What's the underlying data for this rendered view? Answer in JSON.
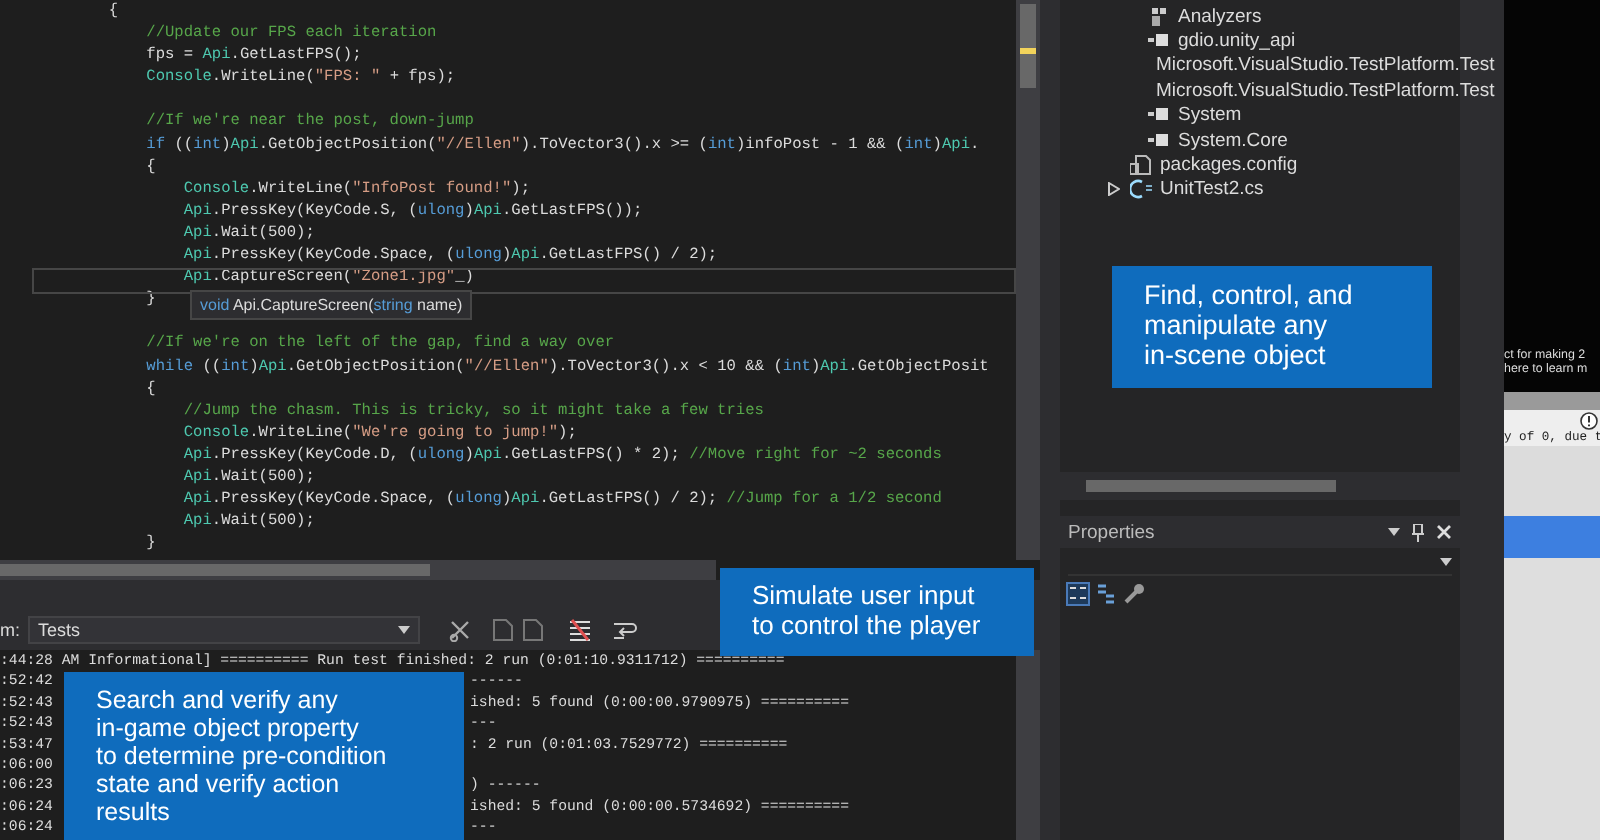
{
  "editor": {
    "lines": [
      {
        "kind": "code",
        "current": false,
        "tokens": [
          {
            "kind": "plain",
            "text": "        {"
          }
        ]
      },
      {
        "kind": "code",
        "current": false,
        "tokens": [
          {
            "kind": "comment",
            "text": "            //Update our FPS each iteration"
          }
        ]
      },
      {
        "kind": "code",
        "current": false,
        "tokens": [
          {
            "kind": "plain",
            "text": "            fps = "
          },
          {
            "kind": "class",
            "text": "Api"
          },
          {
            "kind": "plain",
            "text": ".GetLastFPS();"
          }
        ]
      },
      {
        "kind": "code",
        "current": false,
        "tokens": [
          {
            "kind": "class",
            "text": "            Console"
          },
          {
            "kind": "plain",
            "text": ".WriteLine("
          },
          {
            "kind": "string",
            "text": "\"FPS: \""
          },
          {
            "kind": "plain",
            "text": " + fps);"
          }
        ]
      },
      {
        "kind": "blank",
        "current": false
      },
      {
        "kind": "code",
        "current": false,
        "tokens": [
          {
            "kind": "comment",
            "text": "            //If we're near the post, down-jump"
          }
        ]
      },
      {
        "kind": "code",
        "current": false,
        "tokens": [
          {
            "kind": "keyword",
            "text": "            if"
          },
          {
            "kind": "plain",
            "text": " (("
          },
          {
            "kind": "keyword",
            "text": "int"
          },
          {
            "kind": "plain",
            "text": ")"
          },
          {
            "kind": "class",
            "text": "Api"
          },
          {
            "kind": "plain",
            "text": ".GetObjectPosition("
          },
          {
            "kind": "string",
            "text": "\"//Ellen\""
          },
          {
            "kind": "plain",
            "text": ").ToVector3().x >= ("
          },
          {
            "kind": "keyword",
            "text": "int"
          },
          {
            "kind": "plain",
            "text": ")infoPost - 1 && ("
          },
          {
            "kind": "keyword",
            "text": "int"
          },
          {
            "kind": "plain",
            "text": ")"
          },
          {
            "kind": "class",
            "text": "Api"
          },
          {
            "kind": "plain",
            "text": "."
          }
        ]
      },
      {
        "kind": "code",
        "current": false,
        "tokens": [
          {
            "kind": "plain",
            "text": "            {"
          }
        ]
      },
      {
        "kind": "code",
        "current": false,
        "tokens": [
          {
            "kind": "class",
            "text": "                Console"
          },
          {
            "kind": "plain",
            "text": ".WriteLine("
          },
          {
            "kind": "string",
            "text": "\"InfoPost found!\""
          },
          {
            "kind": "plain",
            "text": ");"
          }
        ]
      },
      {
        "kind": "code",
        "current": false,
        "tokens": [
          {
            "kind": "class",
            "text": "                Api"
          },
          {
            "kind": "plain",
            "text": ".PressKey(KeyCode.S, ("
          },
          {
            "kind": "keyword",
            "text": "ulong"
          },
          {
            "kind": "plain",
            "text": ")"
          },
          {
            "kind": "class",
            "text": "Api"
          },
          {
            "kind": "plain",
            "text": ".GetLastFPS());"
          }
        ]
      },
      {
        "kind": "code",
        "current": false,
        "tokens": [
          {
            "kind": "class",
            "text": "                Api"
          },
          {
            "kind": "plain",
            "text": ".Wait(500);"
          }
        ]
      },
      {
        "kind": "code",
        "current": false,
        "tokens": [
          {
            "kind": "class",
            "text": "                Api"
          },
          {
            "kind": "plain",
            "text": ".PressKey(KeyCode.Space, ("
          },
          {
            "kind": "keyword",
            "text": "ulong"
          },
          {
            "kind": "plain",
            "text": ")"
          },
          {
            "kind": "class",
            "text": "Api"
          },
          {
            "kind": "plain",
            "text": ".GetLastFPS() / 2);"
          }
        ]
      },
      {
        "kind": "code",
        "current": true,
        "tokens": [
          {
            "kind": "class",
            "text": "                Api"
          },
          {
            "kind": "plain",
            "text": ".CaptureScreen("
          },
          {
            "kind": "string",
            "text": "\"Zone1.jpg\""
          },
          {
            "kind": "plain",
            "text": "_)"
          }
        ]
      },
      {
        "kind": "code",
        "current": false,
        "tokens": [
          {
            "kind": "plain",
            "text": "            }"
          }
        ]
      },
      {
        "kind": "blank",
        "current": false
      },
      {
        "kind": "code",
        "current": false,
        "tokens": [
          {
            "kind": "comment",
            "text": "            //If we're on the left of the gap, find a way over"
          }
        ]
      },
      {
        "kind": "code",
        "current": false,
        "tokens": [
          {
            "kind": "keyword",
            "text": "            while"
          },
          {
            "kind": "plain",
            "text": " (("
          },
          {
            "kind": "keyword",
            "text": "int"
          },
          {
            "kind": "plain",
            "text": ")"
          },
          {
            "kind": "class",
            "text": "Api"
          },
          {
            "kind": "plain",
            "text": ".GetObjectPosition("
          },
          {
            "kind": "string",
            "text": "\"//Ellen\""
          },
          {
            "kind": "plain",
            "text": ").ToVector3().x < 10 && ("
          },
          {
            "kind": "keyword",
            "text": "int"
          },
          {
            "kind": "plain",
            "text": ")"
          },
          {
            "kind": "class",
            "text": "Api"
          },
          {
            "kind": "plain",
            "text": ".GetObjectPosit"
          }
        ]
      },
      {
        "kind": "code",
        "current": false,
        "tokens": [
          {
            "kind": "plain",
            "text": "            {"
          }
        ]
      },
      {
        "kind": "code",
        "current": false,
        "tokens": [
          {
            "kind": "comment",
            "text": "                //Jump the chasm. This is tricky, so it might take a few tries"
          }
        ]
      },
      {
        "kind": "code",
        "current": false,
        "tokens": [
          {
            "kind": "class",
            "text": "                Console"
          },
          {
            "kind": "plain",
            "text": ".WriteLine("
          },
          {
            "kind": "string",
            "text": "\"We're going to jump!\""
          },
          {
            "kind": "plain",
            "text": ");"
          }
        ]
      },
      {
        "kind": "code",
        "current": false,
        "tokens": [
          {
            "kind": "class",
            "text": "                Api"
          },
          {
            "kind": "plain",
            "text": ".PressKey(KeyCode.D, ("
          },
          {
            "kind": "keyword",
            "text": "ulong"
          },
          {
            "kind": "plain",
            "text": ")"
          },
          {
            "kind": "class",
            "text": "Api"
          },
          {
            "kind": "plain",
            "text": ".GetLastFPS() * 2); "
          },
          {
            "kind": "comment",
            "text": "//Move right for ~2 seconds"
          }
        ]
      },
      {
        "kind": "code",
        "current": false,
        "tokens": [
          {
            "kind": "class",
            "text": "                Api"
          },
          {
            "kind": "plain",
            "text": ".Wait(500);"
          }
        ]
      },
      {
        "kind": "code",
        "current": false,
        "tokens": [
          {
            "kind": "class",
            "text": "                Api"
          },
          {
            "kind": "plain",
            "text": ".PressKey(KeyCode.Space, ("
          },
          {
            "kind": "keyword",
            "text": "ulong"
          },
          {
            "kind": "plain",
            "text": ")"
          },
          {
            "kind": "class",
            "text": "Api"
          },
          {
            "kind": "plain",
            "text": ".GetLastFPS() / 2); "
          },
          {
            "kind": "comment",
            "text": "//Jump for a 1/2 second"
          }
        ]
      },
      {
        "kind": "code",
        "current": false,
        "tokens": [
          {
            "kind": "class",
            "text": "                Api"
          },
          {
            "kind": "plain",
            "text": ".Wait(500);"
          }
        ]
      },
      {
        "kind": "code",
        "current": false,
        "tokens": [
          {
            "kind": "plain",
            "text": "            }"
          }
        ]
      }
    ],
    "tooltip": {
      "tokens": [
        {
          "kind": "keyword",
          "text": "void"
        },
        {
          "kind": "plain",
          "text": " Api.CaptureScreen("
        },
        {
          "kind": "keyword",
          "text": "string"
        },
        {
          "kind": "plain",
          "text": " name)"
        }
      ]
    }
  },
  "output": {
    "label": "m:",
    "source": "Tests",
    "lines": [
      {
        "left": ":44:28 AM Informational] ========== Run test finished: 2 run (0:01:10.9311712) =========="
      },
      {
        "left": ":52:42",
        "right": "------"
      },
      {
        "left": ":52:43",
        "right": "ished: 5 found (0:00:00.9790975) =========="
      },
      {
        "left": ":52:43",
        "right": "---"
      },
      {
        "left": ":53:47",
        "right": ": 2 run (0:01:03.7529772) =========="
      },
      {
        "left": ":06:00"
      },
      {
        "left": ":06:23",
        "right": ") ------"
      },
      {
        "left": ":06:24",
        "right": "ished: 5 found (0:00:00.5734692) =========="
      },
      {
        "left": ":06:24",
        "right": "---"
      }
    ]
  },
  "solution_explorer": {
    "references": [
      {
        "label": "Analyzers",
        "kind": "analyzer"
      },
      {
        "label": "gdio.unity_api",
        "kind": "reference"
      },
      {
        "label": "Microsoft.VisualStudio.TestPlatform.Test",
        "kind": "reference"
      },
      {
        "label": "Microsoft.VisualStudio.TestPlatform.Test",
        "kind": "reference"
      },
      {
        "label": "System",
        "kind": "reference"
      },
      {
        "label": "System.Core",
        "kind": "reference"
      }
    ],
    "items": [
      {
        "label": "packages.config",
        "kind": "config"
      },
      {
        "label": "UnitTest2.cs",
        "kind": "csharp",
        "expanded": false
      }
    ]
  },
  "properties": {
    "title": "Properties"
  },
  "game_window": {
    "lines": [
      "ct for making 2",
      "here to learn m"
    ],
    "message": "y of 0, due t"
  },
  "callouts": [
    {
      "text": "Find, control, and\nmanipulate any\nin-scene object"
    },
    {
      "text": "Simulate user input\nto control the player"
    },
    {
      "text": "Search and verify any\nin-game object property\nto determine pre-condition\nstate and verify action\nresults"
    }
  ]
}
